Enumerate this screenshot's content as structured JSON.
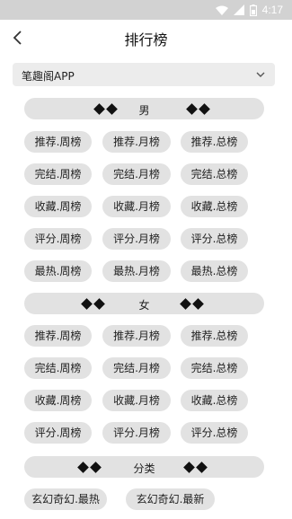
{
  "status_bar": {
    "time": "4:17",
    "icons": [
      "wifi-icon",
      "signal-icon",
      "battery-icon"
    ]
  },
  "header": {
    "title": "排行榜",
    "back_icon": "chevron-left-icon"
  },
  "source_dropdown": {
    "selected": "笔趣阁APP",
    "icon": "chevron-down-icon"
  },
  "sections": {
    "male": {
      "title": "男",
      "rows": [
        [
          "推荐.周榜",
          "推荐.月榜",
          "推荐.总榜"
        ],
        [
          "完结.周榜",
          "完结.月榜",
          "完结.总榜"
        ],
        [
          "收藏.周榜",
          "收藏.月榜",
          "收藏.总榜"
        ],
        [
          "评分.周榜",
          "评分.月榜",
          "评分.总榜"
        ],
        [
          "最热.周榜",
          "最热.月榜",
          "最热.总榜"
        ]
      ]
    },
    "female": {
      "title": "女",
      "rows": [
        [
          "推荐.周榜",
          "推荐.月榜",
          "推荐.总榜"
        ],
        [
          "完结.周榜",
          "完结.月榜",
          "完结.总榜"
        ],
        [
          "收藏.周榜",
          "收藏.月榜",
          "收藏.总榜"
        ],
        [
          "评分.周榜",
          "评分.月榜",
          "评分.总榜"
        ]
      ]
    },
    "category": {
      "title": "分类",
      "items": [
        "玄幻奇幻.最热",
        "玄幻奇幻.最新"
      ]
    }
  },
  "colors": {
    "status_bar": "#d2d2d2",
    "chip_bg": "#e2e2e2",
    "dropdown_bg": "#ececec"
  }
}
